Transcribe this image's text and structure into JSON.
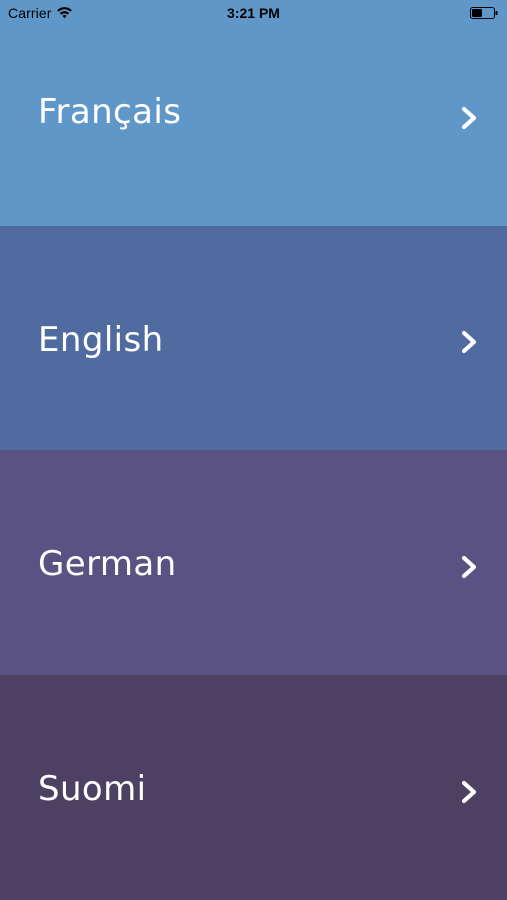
{
  "status_bar": {
    "carrier": "Carrier",
    "time": "3:21 PM",
    "wifi_icon": "wifi-icon",
    "battery_icon": "battery-icon"
  },
  "languages": [
    {
      "label": "Français",
      "color": "#5f97c9",
      "icon": "chevron-right-icon"
    },
    {
      "label": "English",
      "color": "#4f6b9f",
      "icon": "chevron-right-icon"
    },
    {
      "label": "German",
      "color": "#5a5282",
      "icon": "chevron-right-icon"
    },
    {
      "label": "Suomi",
      "color": "#4c4163",
      "icon": "chevron-right-icon"
    }
  ]
}
